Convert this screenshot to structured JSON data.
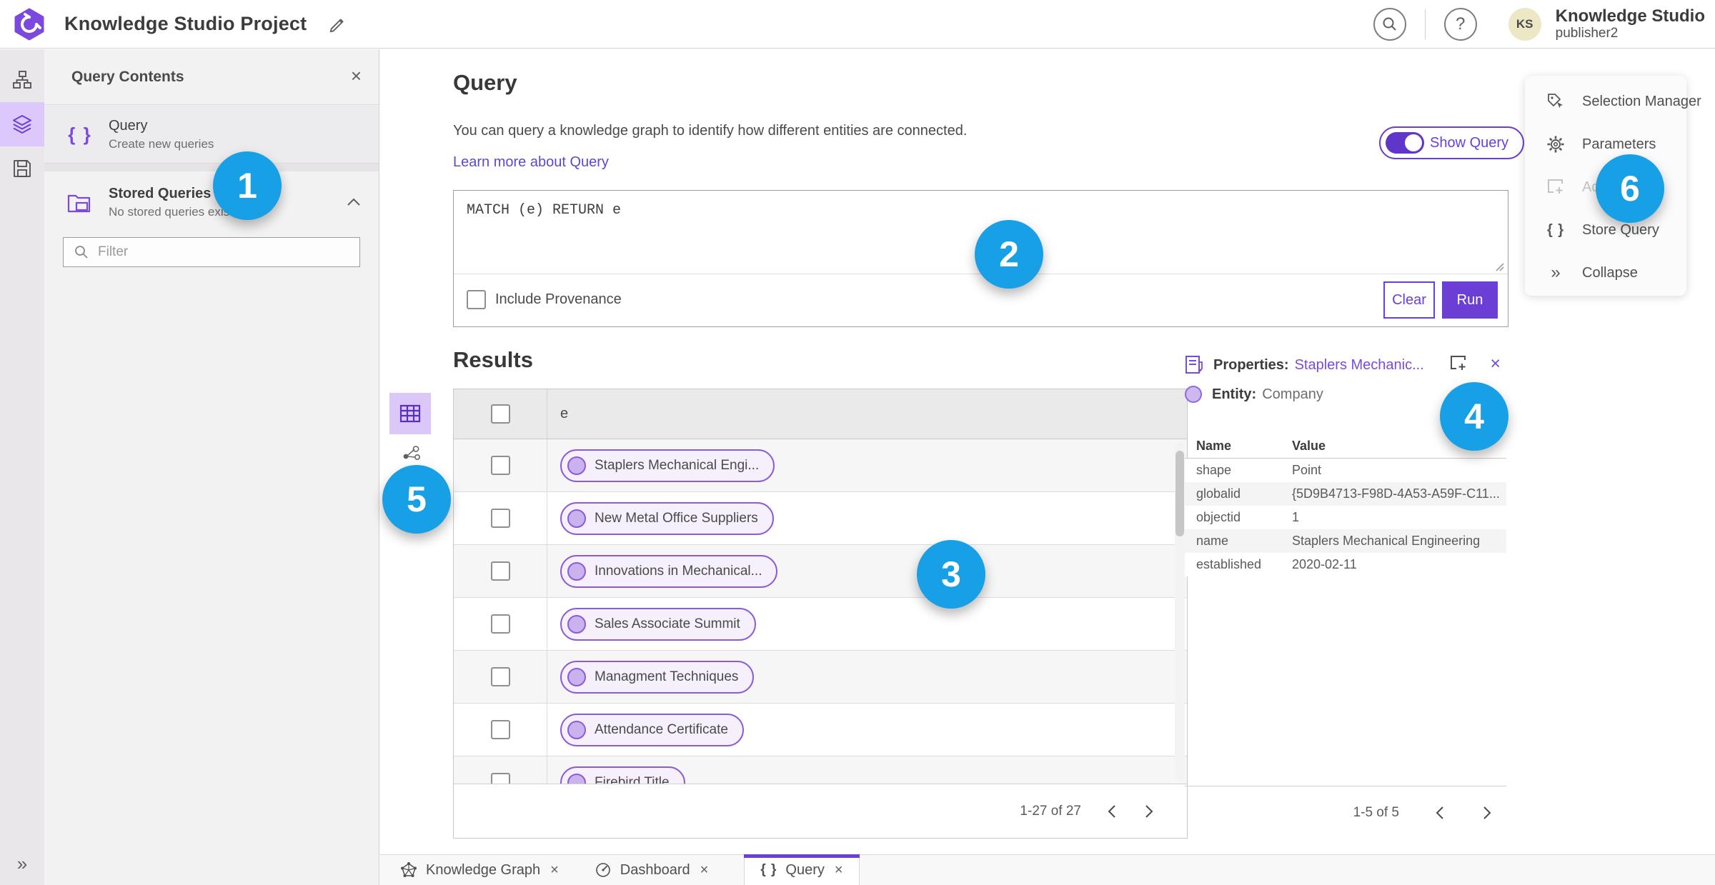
{
  "header": {
    "title": "Knowledge Studio Project",
    "user_name": "Knowledge Studio",
    "user_role": "publisher2",
    "avatar_initials": "KS"
  },
  "contents_panel": {
    "title": "Query Contents",
    "query_item": {
      "label": "Query",
      "description": "Create new queries"
    },
    "stored_item": {
      "label": "Stored Queries",
      "description": "No stored queries exist"
    },
    "filter_placeholder": "Filter"
  },
  "query_section": {
    "title": "Query",
    "description": "You can query a knowledge graph to identify how different entities are connected.",
    "learn_more_label": "Learn more about Query",
    "show_query_label": "Show Query",
    "query_text": "MATCH (e) RETURN e",
    "include_provenance_label": "Include Provenance",
    "clear_label": "Clear",
    "run_label": "Run"
  },
  "results": {
    "title": "Results",
    "column_header": "e",
    "rows": [
      "Staplers Mechanical Engi...",
      "New Metal Office Suppliers",
      "Innovations in Mechanical...",
      "Sales Associate Summit",
      "Managment Techniques",
      "Attendance Certificate",
      "Firebird Title"
    ],
    "pagination": "1-27 of 27"
  },
  "properties_panel": {
    "title_label": "Properties:",
    "title_entity": "Staplers Mechanic...",
    "entity_label": "Entity:",
    "entity_type": "Company",
    "col_name": "Name",
    "col_value": "Value",
    "rows": [
      {
        "name": "shape",
        "value": "Point"
      },
      {
        "name": "globalid",
        "value": "{5D9B4713-F98D-4A53-A59F-C11..."
      },
      {
        "name": "objectid",
        "value": "1"
      },
      {
        "name": "name",
        "value": "Staplers Mechanical Engineering"
      },
      {
        "name": "established",
        "value": "2020-02-11"
      }
    ],
    "pagination": "1-5 of 5"
  },
  "actions_menu": {
    "items": [
      {
        "label": "Selection Manager"
      },
      {
        "label": "Parameters"
      },
      {
        "label": "Ad"
      },
      {
        "label": "Store Query"
      },
      {
        "label": "Collapse"
      }
    ]
  },
  "tabs": [
    {
      "label": "Knowledge Graph"
    },
    {
      "label": "Dashboard"
    },
    {
      "label": "Query"
    }
  ],
  "badges": [
    "1",
    "2",
    "3",
    "4",
    "5",
    "6"
  ],
  "icons": {
    "close": "×",
    "braces": "{ }",
    "help": "?",
    "collapse_chevrons": "»",
    "sidebar_expand": "»"
  },
  "colors": {
    "accent": "#6b3fd6",
    "badge_blue": "#18a0e6",
    "pill_border": "#8a5cd9"
  }
}
